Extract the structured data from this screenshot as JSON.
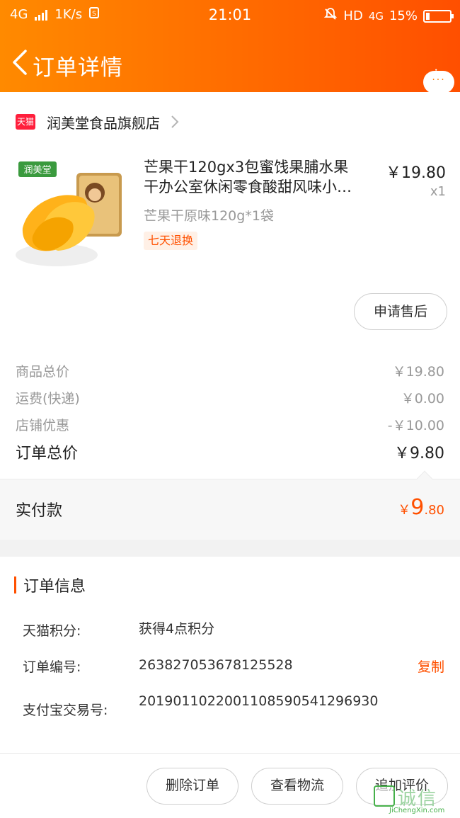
{
  "status_bar": {
    "network": "4G",
    "speed": "1K/s",
    "time": "21:01",
    "hd_label": "HD",
    "network_right": "4G",
    "battery": "15%"
  },
  "header": {
    "title": "订单详情",
    "more_dots": "···"
  },
  "shop": {
    "badge": "天猫",
    "name": "润美堂食品旗舰店"
  },
  "product": {
    "title_line1": "芒果干120gx3包蜜饯果脯水果",
    "title_line2": "干办公室休闲零食酸甜风味小…",
    "price": "￥19.80",
    "quantity": "x1",
    "sku": "芒果干原味120g*1袋",
    "tag": "七天退换",
    "brand_logo": "润美堂",
    "thumb_icon": "dried-mango-product-image"
  },
  "after_sale_button": "申请售后",
  "fees": [
    {
      "label": "商品总价",
      "value": "￥19.80"
    },
    {
      "label": "运费(快递)",
      "value": "￥0.00"
    },
    {
      "label": "店铺优惠",
      "value": "-￥10.00"
    }
  ],
  "total": {
    "label": "订单总价",
    "value": "￥9.80"
  },
  "paid": {
    "label": "实付款",
    "currency": "￥",
    "integer": "9",
    "decimal": ".80"
  },
  "order_info": {
    "heading": "订单信息",
    "rows": [
      {
        "label": "天猫积分:",
        "value": "获得4点积分"
      },
      {
        "label": "订单编号:",
        "value": "263827053678125528",
        "action": "复制"
      },
      {
        "label": "支付宝交易号:",
        "value": "2019011022001108590541296930"
      }
    ]
  },
  "bottom_actions": {
    "delete": "删除订单",
    "logistics": "查看物流",
    "review": "追加评价"
  },
  "watermark": {
    "cn": "诚信",
    "en": "JiChengXin.com"
  },
  "colors": {
    "accent": "#ff5000",
    "header_start": "#ff8a00",
    "header_end": "#ff4f00",
    "tmall_red": "#ff1f3c"
  }
}
